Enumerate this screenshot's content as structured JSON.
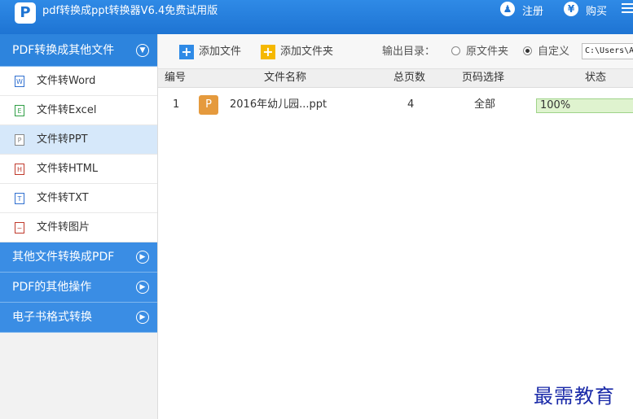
{
  "window": {
    "title": "pdf转换成ppt转换器V6.4免费试用版",
    "register_label": "注册",
    "buy_label": "购买"
  },
  "sidebar": {
    "categories": [
      {
        "label": "PDF转换成其他文件",
        "expanded": true,
        "items": [
          {
            "label": "文件转Word",
            "icon": "word-file-icon",
            "glyph": "W"
          },
          {
            "label": "文件转Excel",
            "icon": "excel-file-icon",
            "glyph": "E"
          },
          {
            "label": "文件转PPT",
            "icon": "ppt-file-icon",
            "glyph": "P",
            "selected": true
          },
          {
            "label": "文件转HTML",
            "icon": "html-file-icon",
            "glyph": "H"
          },
          {
            "label": "文件转TXT",
            "icon": "txt-file-icon",
            "glyph": "T"
          },
          {
            "label": "文件转图片",
            "icon": "image-file-icon",
            "glyph": "~"
          }
        ]
      },
      {
        "label": "其他文件转换成PDF",
        "expanded": false
      },
      {
        "label": "PDF的其他操作",
        "expanded": false
      },
      {
        "label": "电子书格式转换",
        "expanded": false
      }
    ]
  },
  "toolbar": {
    "add_file_label": "添加文件",
    "add_folder_label": "添加文件夹",
    "output_dir_label": "输出目录：",
    "radio_original_label": "原文件夹",
    "radio_custom_label": "自定义",
    "selected_output": "自定义",
    "output_path_value": "C:\\Users\\A"
  },
  "table": {
    "headers": {
      "index": "编号",
      "name": "文件名称",
      "pages": "总页数",
      "page_select": "页码选择",
      "status": "状态"
    },
    "rows": [
      {
        "index": "1",
        "name": "2016年幼儿园...ppt",
        "pages": "4",
        "page_select": "全部",
        "status": "100%",
        "progress": 1.0
      }
    ]
  },
  "colors": {
    "accent": "#2f8ae6",
    "progress_fill": "#dff3cf",
    "ppt_icon": "#e59a3d"
  },
  "watermark": "最需教育"
}
